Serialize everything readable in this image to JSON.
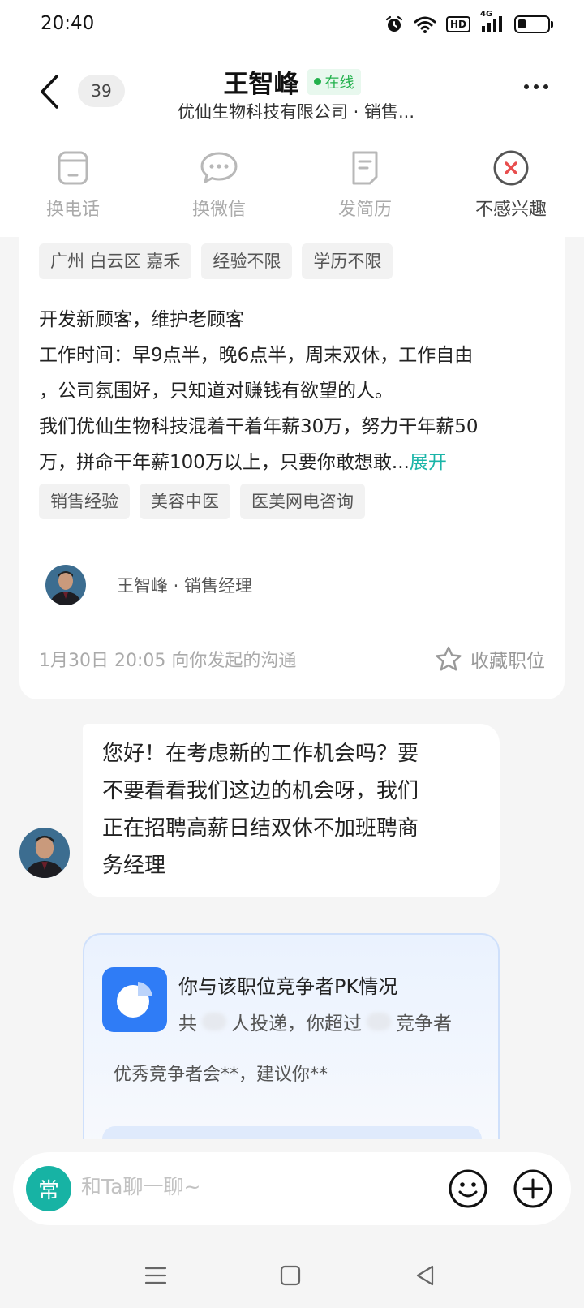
{
  "status_bar": {
    "time": "20:40",
    "icons": [
      "alarm-icon",
      "wifi-icon",
      "hd-icon",
      "signal-4g-icon",
      "battery-icon"
    ],
    "hd_label": "HD",
    "network_label": "4G",
    "battery_level": 0.25
  },
  "header": {
    "unread_count": "39",
    "name": "王智峰",
    "online_label": "在线",
    "subtitle": "优仙生物科技有限公司 · 销售..."
  },
  "actions": {
    "phone": "换电话",
    "wechat": "换微信",
    "resume": "发简历",
    "not_interested": "不感兴趣"
  },
  "job": {
    "tags": [
      "广州 白云区 嘉禾",
      "经验不限",
      "学历不限"
    ],
    "description": [
      "开发新顾客，维护老顾客",
      "工作时间：早9点半，晚6点半，周末双休，工作自由",
      "，公司氛围好，只知道对赚钱有欲望的人。",
      "我们优仙生物科技混着干着年薪30万，努力干年薪50",
      "万，拼命干年薪100万以上，只要你敢想敢..."
    ],
    "expand_label": "展开",
    "skill_tags": [
      "销售经验",
      "美容中医",
      "医美网电咨询"
    ],
    "recruiter": "王智峰 · 销售经理",
    "timeline": "1月30日 20:05 向你发起的沟通",
    "favorite_label": "收藏职位"
  },
  "message": {
    "lines": [
      "您好！在考虑新的工作机会吗？要",
      "不要看看我们这边的机会呀，我们",
      "正在招聘高薪日结双休不加班聘商",
      "务经理"
    ]
  },
  "pk_card": {
    "title": "你与该职位竞争者PK情况",
    "sub_prefix": "共",
    "sub_mid": "人投递，你超过",
    "sub_suffix": "竞争者",
    "note": "优秀竞争者会**，建议你**"
  },
  "input": {
    "common_label": "常",
    "placeholder": "和Ta聊一聊~"
  },
  "colors": {
    "accent": "#17b3a4",
    "online": "#22b14c",
    "pk_blue": "#2f7cf6",
    "not_interested_red": "#e84e4e"
  }
}
